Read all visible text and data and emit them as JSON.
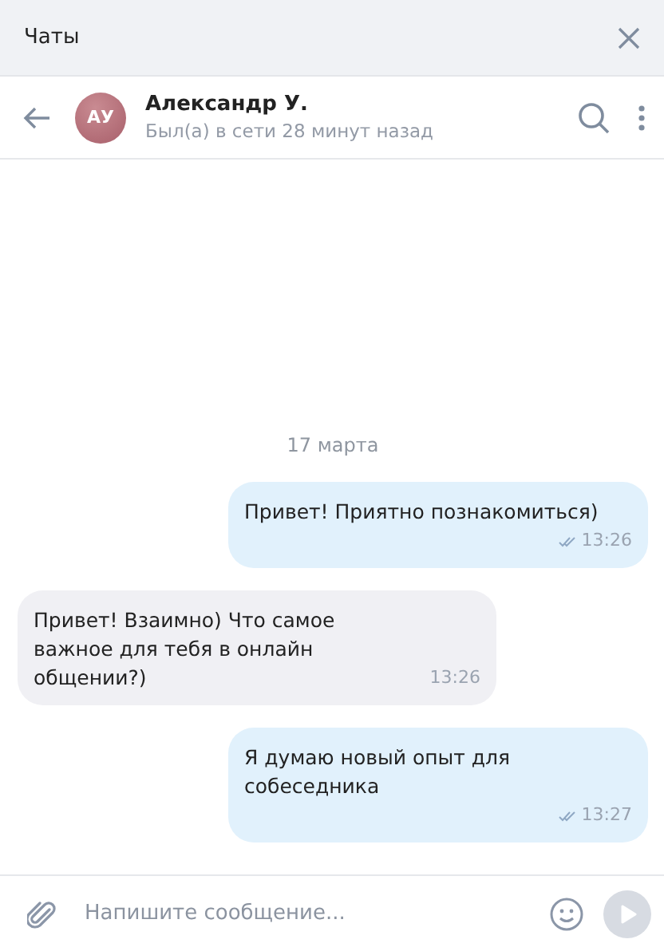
{
  "window": {
    "title": "Чаты"
  },
  "chat_header": {
    "avatar_initials": "АУ",
    "name": "Александр У.",
    "status": "Был(а) в сети 28 минут назад"
  },
  "date_separator": "17 марта",
  "messages": [
    {
      "kind": "outgoing",
      "text": "Привет! Приятно познакомиться)",
      "time": "13:26",
      "read": true
    },
    {
      "kind": "incoming",
      "text": "Привет! Взаимно) Что самое важное для тебя в онлайн общении?)",
      "time": "13:26",
      "read": false
    },
    {
      "kind": "outgoing",
      "text": "Я думаю новый опыт для собеседника",
      "time": "13:27",
      "read": true
    }
  ],
  "composer": {
    "placeholder": "Напишите сообщение..."
  }
}
